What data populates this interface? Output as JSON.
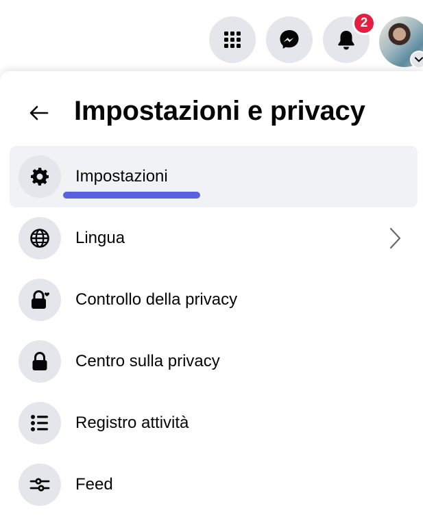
{
  "topbar": {
    "menu_button": "grid-icon",
    "messenger_button": "messenger-icon",
    "notifications_button": "bell-icon",
    "notification_count": "2",
    "badge_color": "#e41e3f",
    "account_button": "avatar"
  },
  "panel": {
    "title": "Impostazioni e privacy",
    "back_icon": "arrow-left-icon"
  },
  "menu": {
    "items": [
      {
        "label": "Impostazioni",
        "icon": "gear-icon",
        "active": true
      },
      {
        "label": "Lingua",
        "icon": "globe-icon",
        "has_submenu": true
      },
      {
        "label": "Controllo della privacy",
        "icon": "lock-heart-icon"
      },
      {
        "label": "Centro sulla privacy",
        "icon": "lock-icon"
      },
      {
        "label": "Registro attività",
        "icon": "list-icon"
      },
      {
        "label": "Feed",
        "icon": "sliders-icon"
      }
    ]
  },
  "colors": {
    "icon_bg": "#e4e6eb",
    "active_bg": "#f0f2f5",
    "highlight": "#4651e0",
    "text": "#050505"
  }
}
